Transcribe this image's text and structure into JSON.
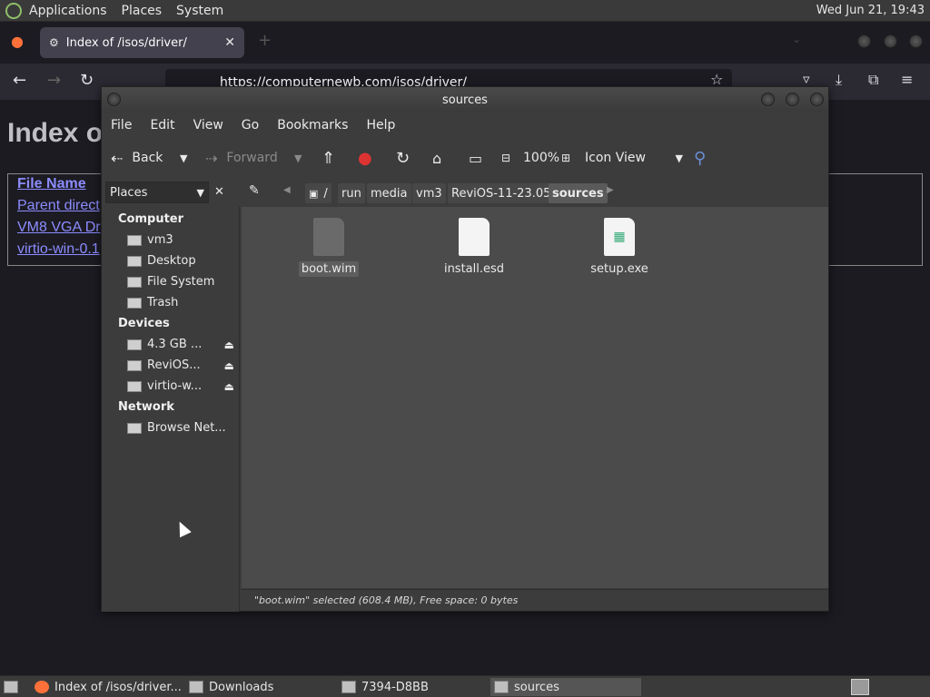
{
  "top_panel": {
    "menus": [
      "Applications",
      "Places",
      "System"
    ],
    "clock": "Wed Jun 21, 19:43"
  },
  "firefox": {
    "tab_title": "Index of /isos/driver/",
    "url": "https://computernewb.com/isos/driver/"
  },
  "webpage": {
    "heading": "Index o",
    "table_header": "File Name",
    "rows": [
      "Parent direct",
      "VM8 VGA Dr",
      "virtio-win-0.1"
    ]
  },
  "file_manager": {
    "title": "sources",
    "menu": [
      "File",
      "Edit",
      "View",
      "Go",
      "Bookmarks",
      "Help"
    ],
    "toolbar": {
      "back": "Back",
      "forward": "Forward",
      "zoom": "100%",
      "view_mode": "Icon View"
    },
    "places_combo": "Places",
    "breadcrumbs": [
      "/",
      "run",
      "media",
      "vm3",
      "ReviOS-11-23.05",
      "sources"
    ],
    "sidebar": {
      "computer_label": "Computer",
      "computer_items": [
        "vm3",
        "Desktop",
        "File System",
        "Trash"
      ],
      "devices_label": "Devices",
      "devices_items": [
        "4.3 GB ...",
        "ReviOS...",
        "virtio-w..."
      ],
      "network_label": "Network",
      "network_items": [
        "Browse Net..."
      ]
    },
    "files": [
      {
        "name": "boot.wim",
        "selected": true
      },
      {
        "name": "install.esd",
        "selected": false
      },
      {
        "name": "setup.exe",
        "selected": false
      }
    ],
    "status": "\"boot.wim\" selected (608.4 MB), Free space: 0 bytes"
  },
  "taskbar": {
    "tasks": [
      "Index of /isos/driver...",
      "Downloads",
      "7394-D8BB",
      "sources"
    ]
  }
}
